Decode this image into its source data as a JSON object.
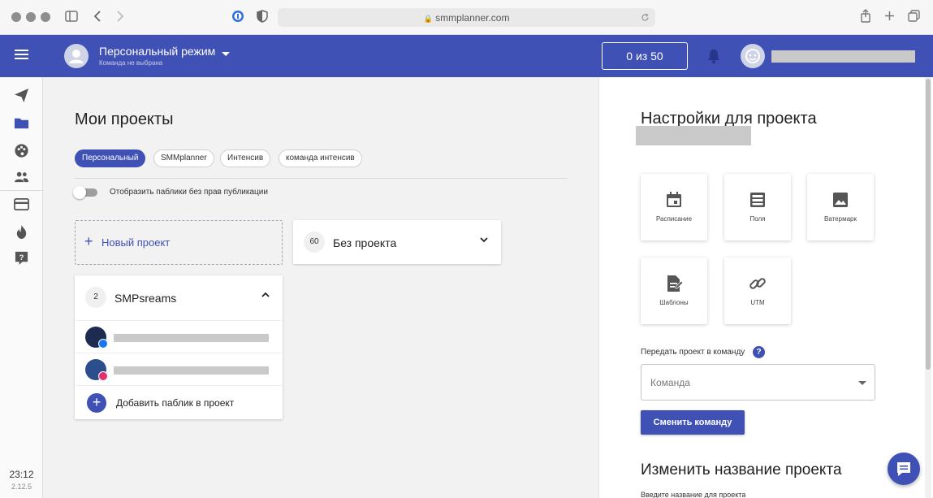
{
  "browser": {
    "url": "smmplanner.com",
    "icons": [
      "sidebar-icon",
      "back-icon",
      "forward-icon",
      "password-icon",
      "shield-icon",
      "lock-icon",
      "reload-icon",
      "share-icon",
      "new-tab-icon",
      "tabs-icon"
    ]
  },
  "header": {
    "mode_title": "Персональный режим",
    "mode_subtitle": "Команда не выбрана",
    "counter": "0 из 50"
  },
  "rail": {
    "items": [
      "send-icon",
      "folder-icon",
      "palette-icon",
      "people-icon",
      "card-icon",
      "flame-icon",
      "help-icon"
    ],
    "time": "23:12",
    "version": "2.12.5"
  },
  "main": {
    "title": "Мои проекты",
    "chips": [
      {
        "label": "Персональный",
        "active": true
      },
      {
        "label": "SMMplanner",
        "active": false
      },
      {
        "label": "Интенсив",
        "active": false
      },
      {
        "label": "команда интенсив",
        "active": false
      }
    ],
    "toggle_label": "Отобразить паблики без прав публикации",
    "new_project": "Новый проект",
    "no_project": {
      "count": "60",
      "title": "Без проекта"
    },
    "project": {
      "count": "2",
      "title": "SMPsreams",
      "accounts": [
        {
          "network": "facebook"
        },
        {
          "network": "instagram"
        }
      ],
      "add_label": "Добавить паблик в проект"
    }
  },
  "settings": {
    "title": "Настройки для проекта",
    "tiles": [
      {
        "label": "Расписание",
        "icon": "calendar-icon"
      },
      {
        "label": "Поля",
        "icon": "fields-icon"
      },
      {
        "label": "Ватермарк",
        "icon": "image-icon"
      },
      {
        "label": "Шаблоны",
        "icon": "template-icon"
      },
      {
        "label": "UTM",
        "icon": "link-icon"
      }
    ],
    "transfer_label": "Передать проект в команду",
    "help": "?",
    "team_placeholder": "Команда",
    "change_button": "Сменить команду",
    "rename_title": "Изменить название проекта",
    "rename_label": "Введите название для проекта"
  },
  "colors": {
    "accent": "#3f51b5",
    "facebook": "#1877f2",
    "instagram": "#e1306c"
  }
}
